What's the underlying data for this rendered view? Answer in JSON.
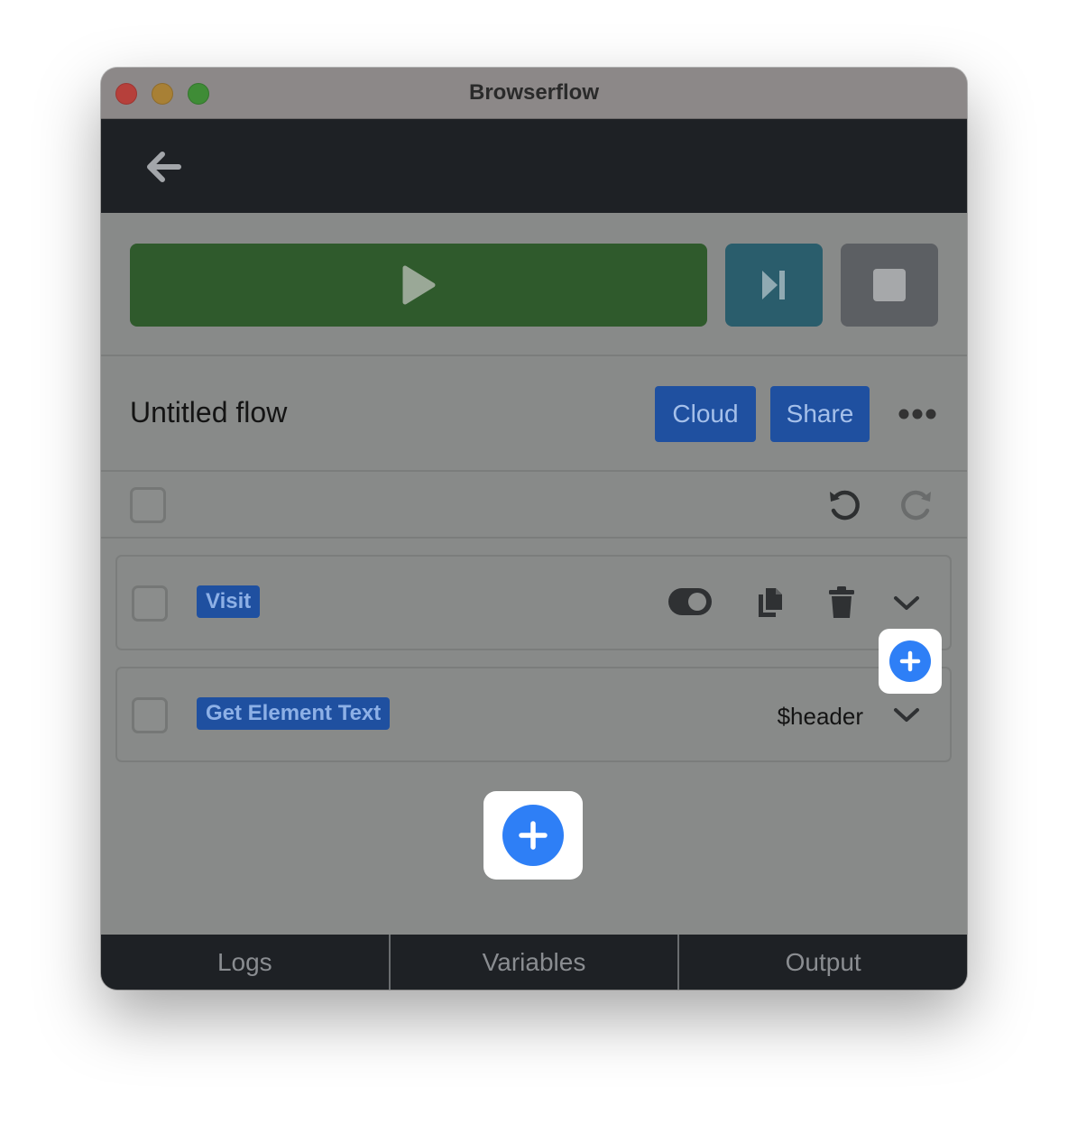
{
  "window": {
    "title": "Browserflow"
  },
  "flow": {
    "title": "Untitled flow"
  },
  "header_buttons": {
    "cloud": "Cloud",
    "share": "Share"
  },
  "steps": [
    {
      "label": "Visit",
      "enabled": true
    },
    {
      "label": "Get Element Text",
      "variable": "$header"
    }
  ],
  "tabs": [
    "Logs",
    "Variables",
    "Output"
  ],
  "colors": {
    "run": "#2f5a2c",
    "step": "#2a5d6c",
    "stop": "#5c5f63",
    "primary": "#1f50a0",
    "add": "#2e7ff6"
  }
}
